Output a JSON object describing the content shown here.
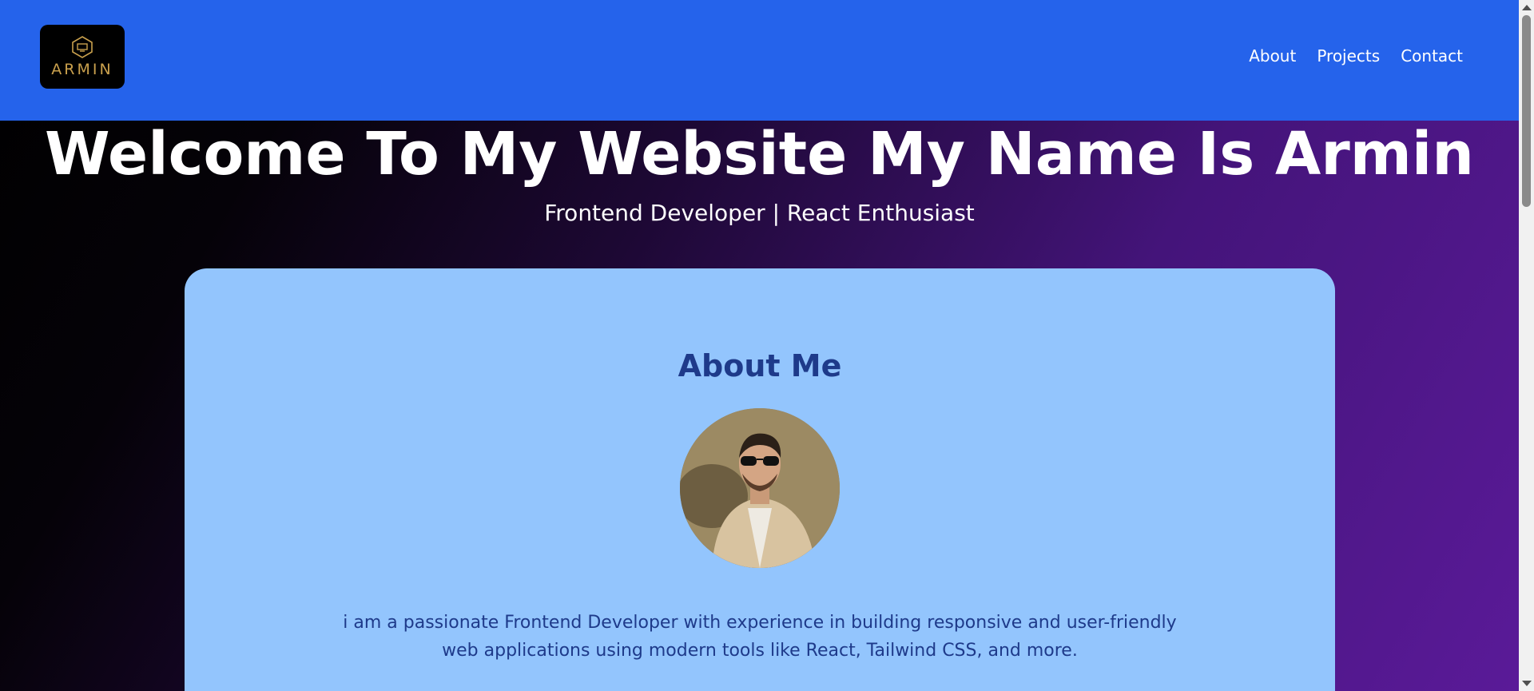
{
  "header": {
    "logo_text": "ARMIN",
    "nav": [
      "About",
      "Projects",
      "Contact"
    ],
    "background": "#2563eb"
  },
  "hero": {
    "title": "Welcome To My Website My Name Is Armin",
    "subtitle": "Frontend Developer | React Enthusiast"
  },
  "about": {
    "heading": "About Me",
    "avatar_icon": "profile-photo",
    "text_line1": "i am a passionate Frontend Developer with experience in building responsive and user-friendly",
    "text_line2": "web applications using modern tools like React, Tailwind CSS, and more.",
    "card_color": "#93c5fd",
    "heading_color": "#1e3a8a"
  }
}
